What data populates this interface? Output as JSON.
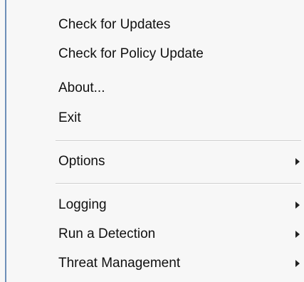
{
  "menu": {
    "items": [
      {
        "label": "Check for Updates",
        "has_submenu": false
      },
      {
        "label": "Check for Policy Update",
        "has_submenu": false
      },
      {
        "label": "About...",
        "has_submenu": false
      },
      {
        "label": "Exit",
        "has_submenu": false
      },
      {
        "label": "Options",
        "has_submenu": true
      },
      {
        "label": "Logging",
        "has_submenu": true
      },
      {
        "label": "Run a Detection",
        "has_submenu": true
      },
      {
        "label": "Threat Management",
        "has_submenu": true
      }
    ],
    "submenu_icon": "chevron-right-icon",
    "accent_border_color": "#6e8fb8"
  }
}
